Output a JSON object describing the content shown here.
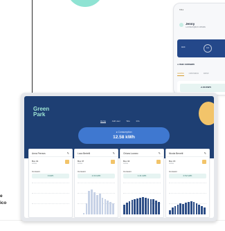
{
  "left_text": [
    "e",
    "ico"
  ],
  "laptop": {
    "brand": [
      "Green",
      "Park"
    ],
    "nav": [
      "Home",
      "Add user",
      "Site",
      "Info"
    ],
    "nav_active": 0,
    "summary": {
      "label": "Consumption",
      "value": "12.58 kWh"
    }
  },
  "cards": [
    {
      "name": "Anna Ferrara",
      "id": "Box 01",
      "sub": "Active",
      "section": "Consumi",
      "value": "0 kWh",
      "bars": []
    },
    {
      "name": "Luca Bertelli",
      "id": "Box 07",
      "sub": "Active",
      "section": "Consumi",
      "value": "2.04 kWh",
      "bars": [
        0.0,
        0.0,
        0.05,
        0.4,
        0.85,
        0.9,
        0.8,
        0.7,
        0.75,
        0.6,
        0.55,
        0.5,
        0.45,
        0.4
      ]
    },
    {
      "name": "Chiara Lozano",
      "id": "Box 04",
      "sub": "Active",
      "section": "Consumi",
      "value": "1.41 kWh",
      "bars": [
        0.35,
        0.42,
        0.48,
        0.52,
        0.55,
        0.58,
        0.6,
        0.62,
        0.6,
        0.58,
        0.56,
        0.54,
        0.5,
        0.46
      ]
    },
    {
      "name": "Nicola Benetti",
      "id": "Box 15",
      "sub": "Active",
      "section": "Consumi",
      "value": "0.52 kWh",
      "bars": [
        0.15,
        0.25,
        0.3,
        0.35,
        0.4,
        0.38,
        0.42,
        0.45,
        0.48,
        0.44,
        0.4,
        0.35,
        0.3,
        0.25
      ]
    }
  ],
  "phone": {
    "status": "9:41",
    "user": "Jenny",
    "user_sub": "Consumption details",
    "card_label": "Box",
    "card_value": "0.0",
    "section": "1 hub consumi",
    "tabs": [
      "Giorno",
      "Settimana",
      "Mese"
    ],
    "active_tab": 0,
    "row_value": "2.04 kWh"
  },
  "colors": {
    "hero": "#1e3f73",
    "pill": "#3f78d0",
    "accent_teal": "#9ee4d3",
    "accent_yellow": "#f2c46a",
    "bar_blue": "#2c4d86"
  }
}
